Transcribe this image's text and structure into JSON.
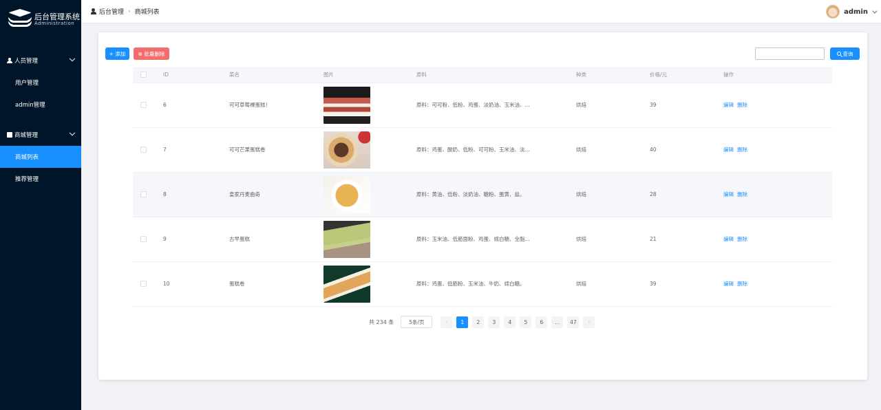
{
  "logo": {
    "title": "后台管理系统",
    "subtitle": "Administration"
  },
  "sidebar": {
    "groups": [
      {
        "label": "人员管理",
        "items": [
          "用户管理",
          "admin管理"
        ]
      },
      {
        "label": "商城管理",
        "items": [
          "商城列表",
          "推荐管理"
        ]
      }
    ]
  },
  "header": {
    "breadcrumb": [
      "后台管理",
      "商城列表"
    ],
    "user": "admin"
  },
  "toolbar": {
    "add": "+ 添加",
    "batch_delete": "⊗ 批量删除",
    "search": "查询",
    "search_value": ""
  },
  "table": {
    "columns": [
      "",
      "ID",
      "菜名",
      "图片",
      "原料",
      "种类",
      "价格/元",
      "操作"
    ],
    "rows": [
      {
        "id": "6",
        "name": "可可草莓裸蛋糕！",
        "ingredients": "原料：可可粉、低粉、鸡蛋、淡奶油、玉米油、...",
        "type": "烘焙",
        "price": "39"
      },
      {
        "id": "7",
        "name": "可可芒果蛋糕卷",
        "ingredients": "原料：鸡蛋、酸奶、低粉、可可粉、玉米油、淡...",
        "type": "烘焙",
        "price": "40"
      },
      {
        "id": "8",
        "name": "皇家丹麦曲奇",
        "ingredients": "原料：黄油、低粉、淡奶油、糖粉、蛋黄、盐。",
        "type": "烘焙",
        "price": "28"
      },
      {
        "id": "9",
        "name": "古早蛋糕",
        "ingredients": "原料：玉米油、低筋面粉、鸡蛋、绵白糖、全脂...",
        "type": "烘焙",
        "price": "21"
      },
      {
        "id": "10",
        "name": "蛋糕卷",
        "ingredients": "原料：鸡蛋、低筋粉、玉米油、牛奶、绵白糖。",
        "type": "烘焙",
        "price": "39"
      }
    ],
    "edit": "编辑",
    "delete": "删除"
  },
  "pagination": {
    "total": "共 234 条",
    "page_size": "5条/页",
    "pages": [
      "1",
      "2",
      "3",
      "4",
      "5",
      "6",
      "...",
      "47"
    ],
    "current": "1",
    "prev": "‹",
    "next": "›"
  }
}
